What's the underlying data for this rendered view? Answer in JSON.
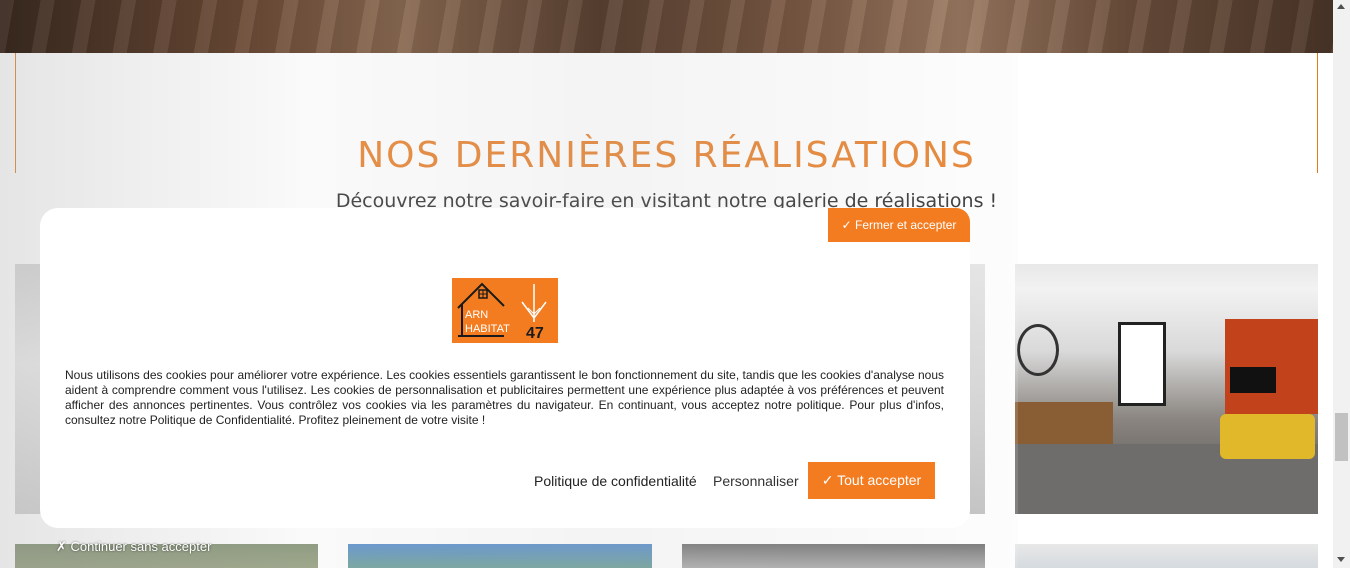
{
  "section": {
    "title": "NOS DERNIÈRES RÉALISATIONS",
    "subtitle": "Découvrez notre savoir-faire en visitant notre galerie de réalisations !"
  },
  "cookie_modal": {
    "close_accept_label": "✓ Fermer et accepter",
    "logo_text_line1": "ARN",
    "logo_text_line2": "HABITAT",
    "logo_text_num": "47",
    "body": "Nous utilisons des cookies pour améliorer votre expérience. Les cookies essentiels garantissent le bon fonctionnement du site, tandis que les cookies d'analyse nous aident à comprendre comment vous l'utilisez. Les cookies de personnalisation et publicitaires permettent une expérience plus adaptée à vos préférences et peuvent afficher des annonces pertinentes. Vous contrôlez vos cookies via les paramètres du navigateur. En continuant, vous acceptez notre politique. Pour plus d'infos, consultez notre Politique de Confidentialité. Profitez pleinement de votre visite !",
    "privacy_link": "Politique de confidentialité",
    "customize_link": "Personnaliser",
    "accept_all_label": "✓ Tout accepter",
    "continue_label": "✗ Continuer sans accepter"
  },
  "colors": {
    "accent": "#f47c20",
    "title": "#e5781e"
  }
}
